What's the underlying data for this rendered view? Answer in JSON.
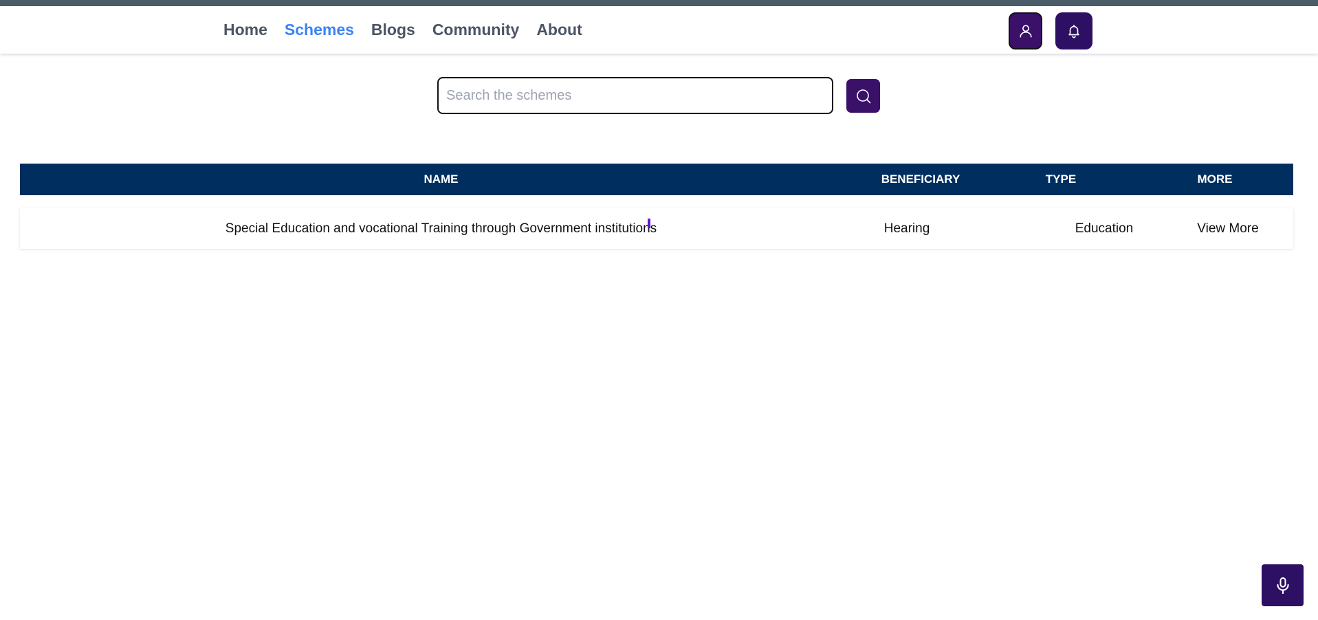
{
  "nav": {
    "items": [
      {
        "label": "Home",
        "active": false
      },
      {
        "label": "Schemes",
        "active": true
      },
      {
        "label": "Blogs",
        "active": false
      },
      {
        "label": "Community",
        "active": false
      },
      {
        "label": "About",
        "active": false
      }
    ],
    "icons": {
      "profile": "user-icon",
      "notifications": "bell-icon"
    }
  },
  "search": {
    "placeholder": "Search the schemes",
    "value": "",
    "icon": "search-icon"
  },
  "table": {
    "headers": [
      "NAME",
      "BENEFICIARY",
      "TYPE",
      "MORE"
    ],
    "rows": [
      {
        "name": "Special Education and vocational Training through Government institutions",
        "beneficiary": "Hearing",
        "type": "Education",
        "more": "View More"
      }
    ]
  },
  "voice": {
    "icon": "microphone-icon"
  },
  "colors": {
    "accent": "#3b82f6",
    "button_purple": "#2d0f63",
    "header_navy": "#002f5f",
    "top_strip": "#4a5c68"
  }
}
